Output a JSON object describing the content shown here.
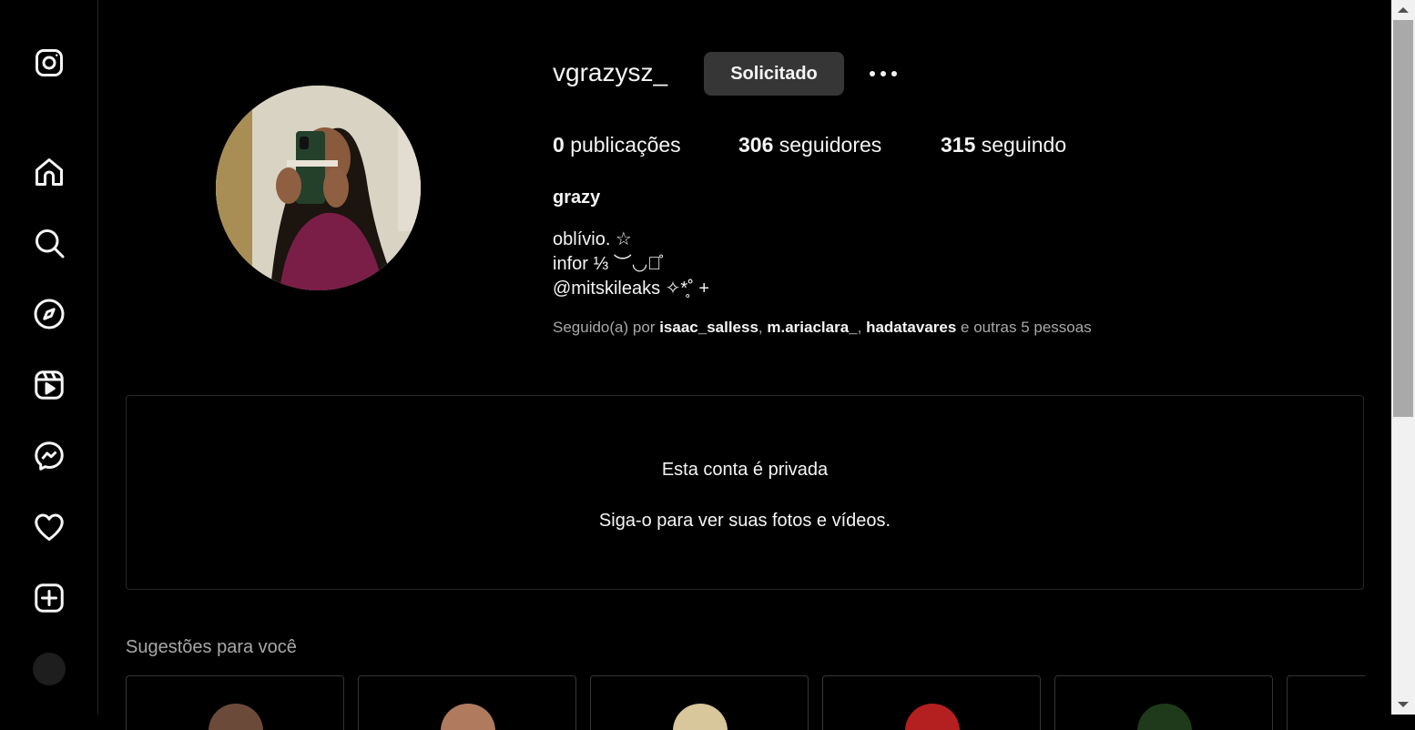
{
  "profile": {
    "username": "vgrazysz_",
    "follow_button": "Solicitado",
    "stats": [
      {
        "count": "0",
        "label": "publicações"
      },
      {
        "count": "306",
        "label": "seguidores"
      },
      {
        "count": "315",
        "label": "seguindo"
      }
    ],
    "full_name": "grazy",
    "bio": [
      "oblívio. ☆",
      "infor ⅓ ︶◡꒱̊",
      "@mitskileaks ✧*̥˚ +"
    ],
    "followed_by": {
      "prefix": "Seguido(a) por",
      "users": [
        "isaac_salless",
        "m.ariaclara_",
        "hadatavares"
      ],
      "suffix": "e outras 5 pessoas"
    }
  },
  "private_notice": {
    "title": "Esta conta é privada",
    "subtitle": "Siga-o para ver suas fotos e vídeos."
  },
  "suggestions": {
    "title": "Sugestões para você",
    "avatar_colors": [
      "#6b4a3a",
      "#b07a5e",
      "#d8c79a",
      "#b41f1f",
      "#1f3a1a"
    ]
  },
  "sidebar_icons": [
    "instagram-icon",
    "home-icon",
    "search-icon",
    "explore-icon",
    "reels-icon",
    "messenger-icon",
    "heart-icon",
    "create-icon"
  ]
}
